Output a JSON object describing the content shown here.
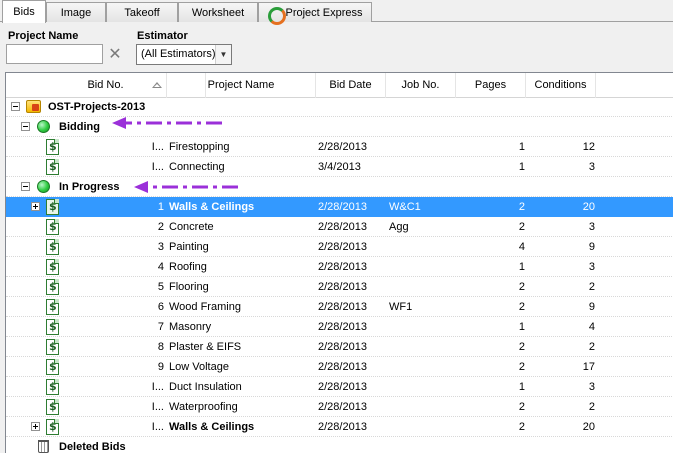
{
  "tabs": [
    {
      "label": "Bids",
      "active": true
    },
    {
      "label": "Image",
      "active": false
    },
    {
      "label": "Takeoff",
      "active": false
    },
    {
      "label": "Worksheet",
      "active": false
    },
    {
      "label": "Project Express",
      "active": false,
      "icon": "project-express-icon"
    }
  ],
  "filters": {
    "project_name_label": "Project Name",
    "project_name_value": "",
    "clear_icon": "✕",
    "estimator_label": "Estimator",
    "estimator_value": "(All Estimators)"
  },
  "columns": [
    "Bid No.",
    "Project Name",
    "Bid Date",
    "Job No.",
    "Pages",
    "Conditions"
  ],
  "tree": {
    "root_label": "OST-Projects-2013",
    "groups": [
      {
        "label": "Bidding"
      },
      {
        "label": "In Progress"
      }
    ],
    "deleted_label": "Deleted Bids"
  },
  "bidding_rows": [
    {
      "bid_no": "I...",
      "project": "Firestopping",
      "bid_date": "2/28/2013",
      "job_no": "",
      "pages": "1",
      "conditions": "12"
    },
    {
      "bid_no": "I...",
      "project": "Connecting",
      "bid_date": "3/4/2013",
      "job_no": "",
      "pages": "1",
      "conditions": "3"
    }
  ],
  "in_progress_rows": [
    {
      "bid_no": "1",
      "project": "Walls & Ceilings",
      "bid_date": "2/28/2013",
      "job_no": "W&C1",
      "pages": "2",
      "conditions": "20"
    },
    {
      "bid_no": "2",
      "project": "Concrete",
      "bid_date": "2/28/2013",
      "job_no": "Agg",
      "pages": "2",
      "conditions": "3"
    },
    {
      "bid_no": "3",
      "project": "Painting",
      "bid_date": "2/28/2013",
      "job_no": "",
      "pages": "4",
      "conditions": "9"
    },
    {
      "bid_no": "4",
      "project": "Roofing",
      "bid_date": "2/28/2013",
      "job_no": "",
      "pages": "1",
      "conditions": "3"
    },
    {
      "bid_no": "5",
      "project": "Flooring",
      "bid_date": "2/28/2013",
      "job_no": "",
      "pages": "2",
      "conditions": "2"
    },
    {
      "bid_no": "6",
      "project": "Wood Framing",
      "bid_date": "2/28/2013",
      "job_no": "WF1",
      "pages": "2",
      "conditions": "9"
    },
    {
      "bid_no": "7",
      "project": "Masonry",
      "bid_date": "2/28/2013",
      "job_no": "",
      "pages": "1",
      "conditions": "4"
    },
    {
      "bid_no": "8",
      "project": "Plaster & EIFS",
      "bid_date": "2/28/2013",
      "job_no": "",
      "pages": "2",
      "conditions": "2"
    },
    {
      "bid_no": "9",
      "project": "Low Voltage",
      "bid_date": "2/28/2013",
      "job_no": "",
      "pages": "2",
      "conditions": "17"
    },
    {
      "bid_no": "I...",
      "project": "Duct Insulation",
      "bid_date": "2/28/2013",
      "job_no": "",
      "pages": "1",
      "conditions": "3"
    },
    {
      "bid_no": "I...",
      "project": "Waterproofing",
      "bid_date": "2/28/2013",
      "job_no": "",
      "pages": "2",
      "conditions": "2"
    },
    {
      "bid_no": "I...",
      "project": "Walls & Ceilings",
      "bid_date": "2/28/2013",
      "job_no": "",
      "pages": "2",
      "conditions": "20"
    }
  ],
  "colors": {
    "selection": "#3399ff",
    "annotation_arrow": "#9b30d9",
    "status_green": "#2ecc40"
  }
}
